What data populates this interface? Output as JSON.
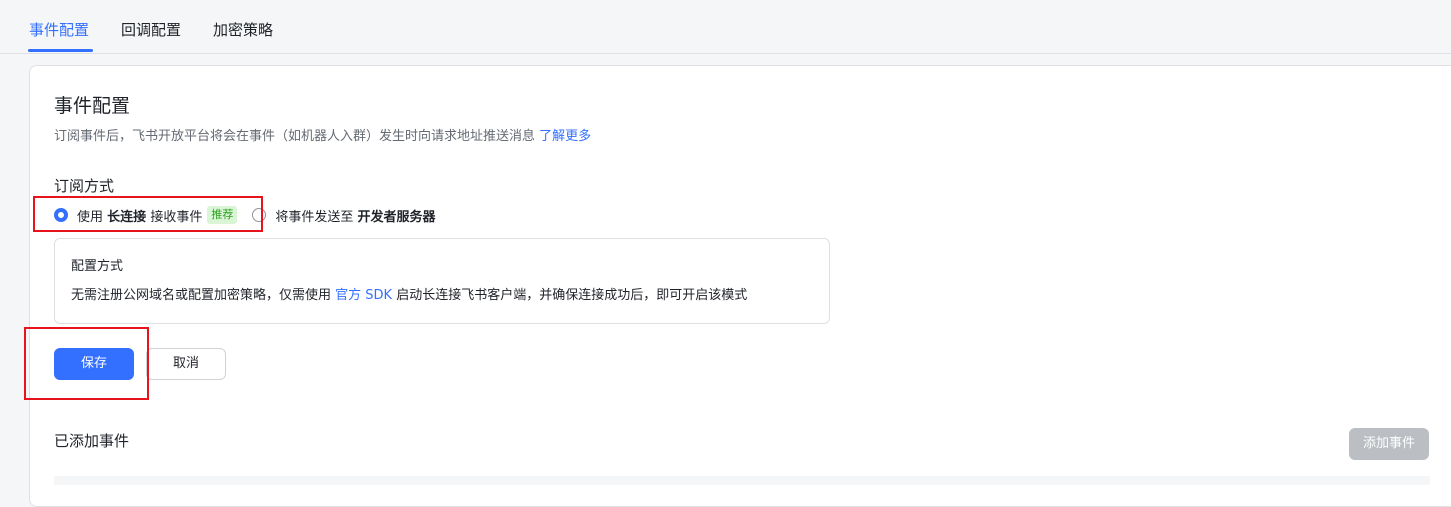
{
  "tabs": [
    {
      "label": "事件配置",
      "active": true
    },
    {
      "label": "回调配置",
      "active": false
    },
    {
      "label": "加密策略",
      "active": false
    }
  ],
  "section": {
    "title": "事件配置",
    "description": "订阅事件后，飞书开放平台将会在事件（如机器人入群）发生时向请求地址推送消息",
    "learn_more": "了解更多"
  },
  "subscription": {
    "label": "订阅方式",
    "option1": {
      "prefix": "使用",
      "bold": "长连接",
      "suffix": "接收事件",
      "badge": "推荐",
      "checked": true
    },
    "option2": {
      "prefix": "将事件发送至",
      "bold": "开发者服务器",
      "checked": false
    }
  },
  "config_box": {
    "title": "配置方式",
    "text_before": "无需注册公网域名或配置加密策略，仅需使用",
    "link": "官方 SDK",
    "text_after": "启动长连接飞书客户端，并确保连接成功后，即可开启该模式"
  },
  "buttons": {
    "save": "保存",
    "cancel": "取消"
  },
  "added_events": {
    "title": "已添加事件",
    "add_button": "添加事件"
  },
  "colors": {
    "accent": "#3370ff",
    "highlight_box": "#e8141c",
    "badge_bg": "#d9f5d6",
    "badge_text": "#2ea121"
  }
}
